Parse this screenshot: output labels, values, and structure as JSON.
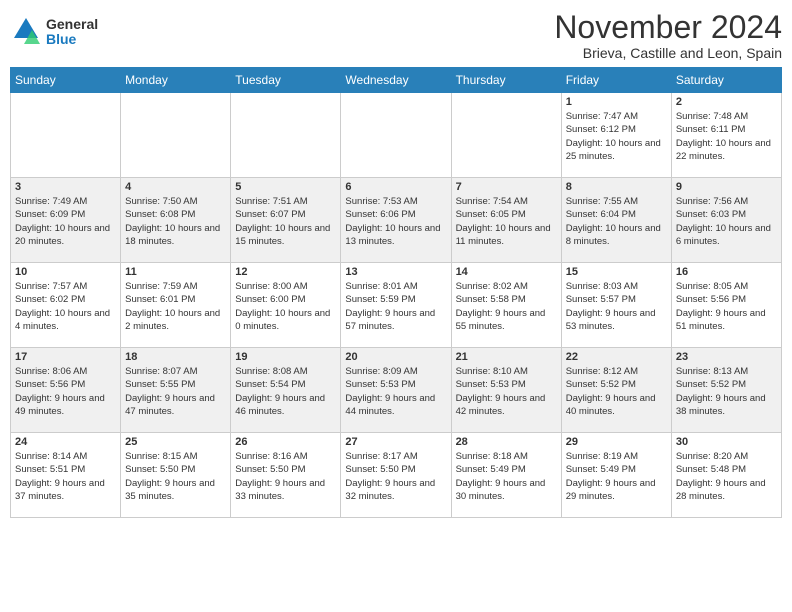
{
  "header": {
    "logo_general": "General",
    "logo_blue": "Blue",
    "month_title": "November 2024",
    "location": "Brieva, Castille and Leon, Spain"
  },
  "days_of_week": [
    "Sunday",
    "Monday",
    "Tuesday",
    "Wednesday",
    "Thursday",
    "Friday",
    "Saturday"
  ],
  "rows": [
    [
      {
        "num": "",
        "detail": ""
      },
      {
        "num": "",
        "detail": ""
      },
      {
        "num": "",
        "detail": ""
      },
      {
        "num": "",
        "detail": ""
      },
      {
        "num": "",
        "detail": ""
      },
      {
        "num": "1",
        "detail": "Sunrise: 7:47 AM\nSunset: 6:12 PM\nDaylight: 10 hours and 25 minutes."
      },
      {
        "num": "2",
        "detail": "Sunrise: 7:48 AM\nSunset: 6:11 PM\nDaylight: 10 hours and 22 minutes."
      }
    ],
    [
      {
        "num": "3",
        "detail": "Sunrise: 7:49 AM\nSunset: 6:09 PM\nDaylight: 10 hours and 20 minutes."
      },
      {
        "num": "4",
        "detail": "Sunrise: 7:50 AM\nSunset: 6:08 PM\nDaylight: 10 hours and 18 minutes."
      },
      {
        "num": "5",
        "detail": "Sunrise: 7:51 AM\nSunset: 6:07 PM\nDaylight: 10 hours and 15 minutes."
      },
      {
        "num": "6",
        "detail": "Sunrise: 7:53 AM\nSunset: 6:06 PM\nDaylight: 10 hours and 13 minutes."
      },
      {
        "num": "7",
        "detail": "Sunrise: 7:54 AM\nSunset: 6:05 PM\nDaylight: 10 hours and 11 minutes."
      },
      {
        "num": "8",
        "detail": "Sunrise: 7:55 AM\nSunset: 6:04 PM\nDaylight: 10 hours and 8 minutes."
      },
      {
        "num": "9",
        "detail": "Sunrise: 7:56 AM\nSunset: 6:03 PM\nDaylight: 10 hours and 6 minutes."
      }
    ],
    [
      {
        "num": "10",
        "detail": "Sunrise: 7:57 AM\nSunset: 6:02 PM\nDaylight: 10 hours and 4 minutes."
      },
      {
        "num": "11",
        "detail": "Sunrise: 7:59 AM\nSunset: 6:01 PM\nDaylight: 10 hours and 2 minutes."
      },
      {
        "num": "12",
        "detail": "Sunrise: 8:00 AM\nSunset: 6:00 PM\nDaylight: 10 hours and 0 minutes."
      },
      {
        "num": "13",
        "detail": "Sunrise: 8:01 AM\nSunset: 5:59 PM\nDaylight: 9 hours and 57 minutes."
      },
      {
        "num": "14",
        "detail": "Sunrise: 8:02 AM\nSunset: 5:58 PM\nDaylight: 9 hours and 55 minutes."
      },
      {
        "num": "15",
        "detail": "Sunrise: 8:03 AM\nSunset: 5:57 PM\nDaylight: 9 hours and 53 minutes."
      },
      {
        "num": "16",
        "detail": "Sunrise: 8:05 AM\nSunset: 5:56 PM\nDaylight: 9 hours and 51 minutes."
      }
    ],
    [
      {
        "num": "17",
        "detail": "Sunrise: 8:06 AM\nSunset: 5:56 PM\nDaylight: 9 hours and 49 minutes."
      },
      {
        "num": "18",
        "detail": "Sunrise: 8:07 AM\nSunset: 5:55 PM\nDaylight: 9 hours and 47 minutes."
      },
      {
        "num": "19",
        "detail": "Sunrise: 8:08 AM\nSunset: 5:54 PM\nDaylight: 9 hours and 46 minutes."
      },
      {
        "num": "20",
        "detail": "Sunrise: 8:09 AM\nSunset: 5:53 PM\nDaylight: 9 hours and 44 minutes."
      },
      {
        "num": "21",
        "detail": "Sunrise: 8:10 AM\nSunset: 5:53 PM\nDaylight: 9 hours and 42 minutes."
      },
      {
        "num": "22",
        "detail": "Sunrise: 8:12 AM\nSunset: 5:52 PM\nDaylight: 9 hours and 40 minutes."
      },
      {
        "num": "23",
        "detail": "Sunrise: 8:13 AM\nSunset: 5:52 PM\nDaylight: 9 hours and 38 minutes."
      }
    ],
    [
      {
        "num": "24",
        "detail": "Sunrise: 8:14 AM\nSunset: 5:51 PM\nDaylight: 9 hours and 37 minutes."
      },
      {
        "num": "25",
        "detail": "Sunrise: 8:15 AM\nSunset: 5:50 PM\nDaylight: 9 hours and 35 minutes."
      },
      {
        "num": "26",
        "detail": "Sunrise: 8:16 AM\nSunset: 5:50 PM\nDaylight: 9 hours and 33 minutes."
      },
      {
        "num": "27",
        "detail": "Sunrise: 8:17 AM\nSunset: 5:50 PM\nDaylight: 9 hours and 32 minutes."
      },
      {
        "num": "28",
        "detail": "Sunrise: 8:18 AM\nSunset: 5:49 PM\nDaylight: 9 hours and 30 minutes."
      },
      {
        "num": "29",
        "detail": "Sunrise: 8:19 AM\nSunset: 5:49 PM\nDaylight: 9 hours and 29 minutes."
      },
      {
        "num": "30",
        "detail": "Sunrise: 8:20 AM\nSunset: 5:48 PM\nDaylight: 9 hours and 28 minutes."
      }
    ]
  ]
}
